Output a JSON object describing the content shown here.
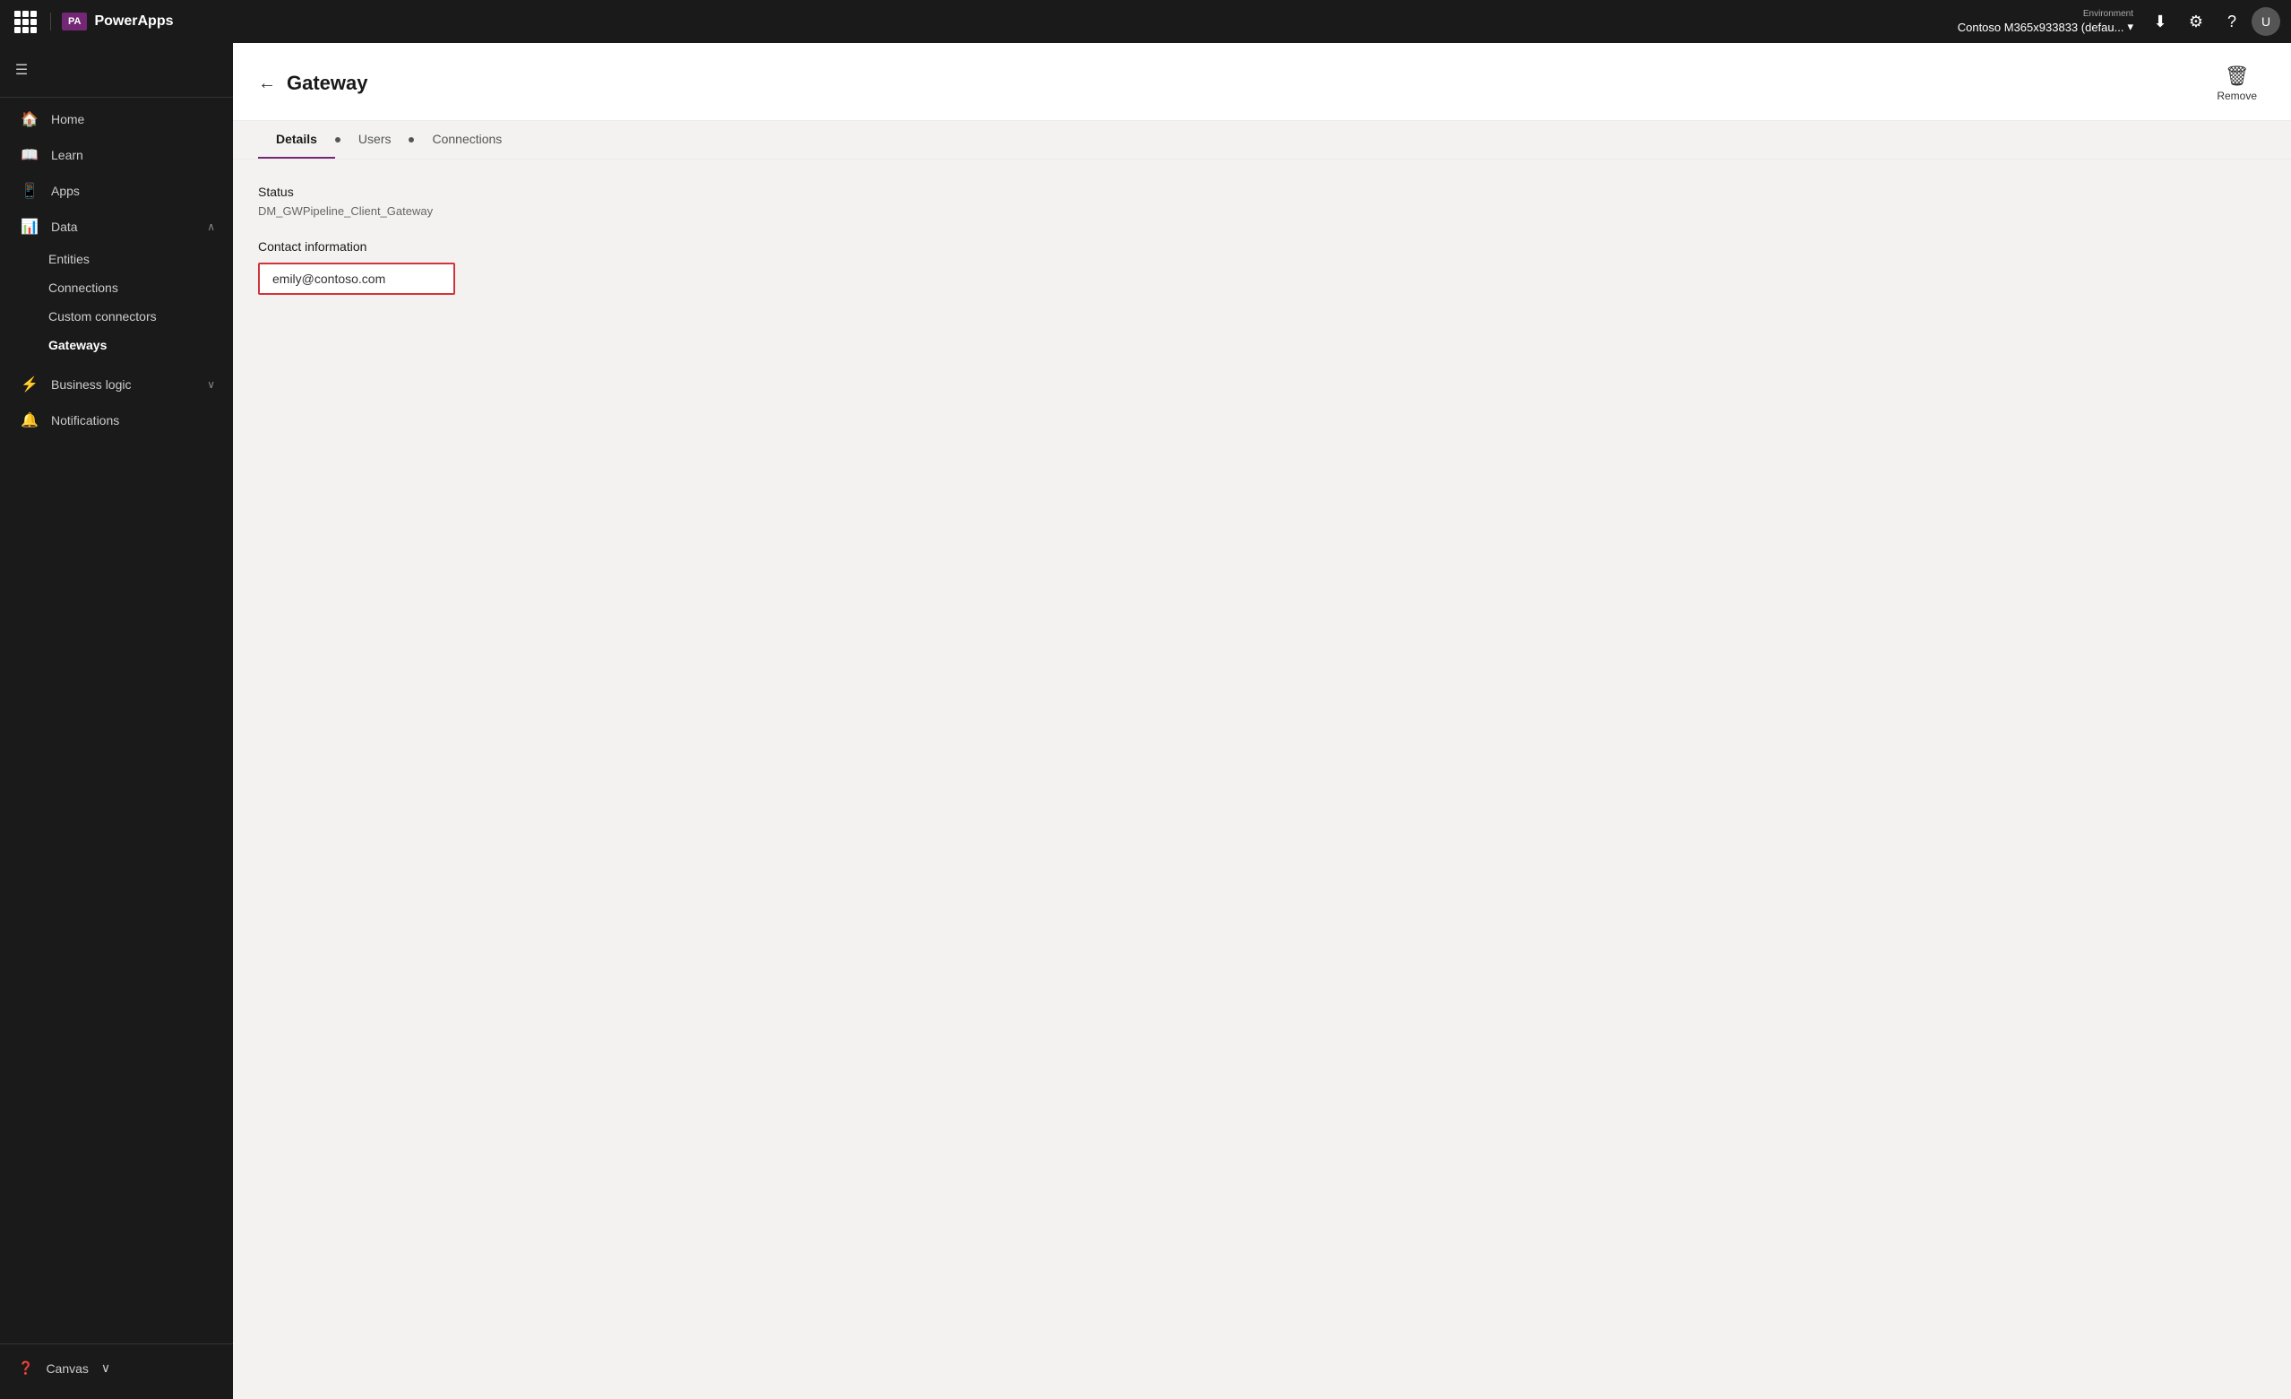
{
  "topbar": {
    "brand_label": "PowerApps",
    "env_label": "Environment",
    "env_value": "Contoso M365x933833 (defau...",
    "download_icon": "⬇",
    "settings_icon": "⚙",
    "help_icon": "?",
    "avatar_label": "U"
  },
  "sidebar": {
    "hamburger_label": "☰",
    "items": [
      {
        "id": "home",
        "icon": "🏠",
        "label": "Home",
        "active": false
      },
      {
        "id": "learn",
        "icon": "📖",
        "label": "Learn",
        "active": false
      },
      {
        "id": "apps",
        "icon": "📱",
        "label": "Apps",
        "active": false
      },
      {
        "id": "data",
        "icon": "📊",
        "label": "Data",
        "active": false,
        "chevron": "∧",
        "expanded": true
      }
    ],
    "data_children": [
      {
        "id": "entities",
        "label": "Entities",
        "active": false
      },
      {
        "id": "connections",
        "label": "Connections",
        "active": false
      },
      {
        "id": "custom-connectors",
        "label": "Custom connectors",
        "active": false
      },
      {
        "id": "gateways",
        "label": "Gateways",
        "active": true
      }
    ],
    "bottom_items": [
      {
        "id": "business-logic",
        "icon": "⚡",
        "label": "Business logic",
        "chevron": "∨"
      },
      {
        "id": "notifications",
        "icon": "🔔",
        "label": "Notifications"
      }
    ],
    "footer_item": {
      "icon": "❓",
      "label": "Canvas",
      "chevron": "∨"
    }
  },
  "page": {
    "title": "Gateway",
    "back_label": "←",
    "remove_label": "Remove"
  },
  "tabs": [
    {
      "id": "details",
      "label": "Details",
      "active": true,
      "dot": false
    },
    {
      "id": "users",
      "label": "Users",
      "active": false,
      "dot": true
    },
    {
      "id": "connections",
      "label": "Connections",
      "active": false,
      "dot": true
    }
  ],
  "content": {
    "status_label": "Status",
    "status_value": "DM_GWPipeline_Client_Gateway",
    "contact_label": "Contact information",
    "contact_value": "emily@contoso.com",
    "contact_placeholder": "emily@contoso.com"
  }
}
